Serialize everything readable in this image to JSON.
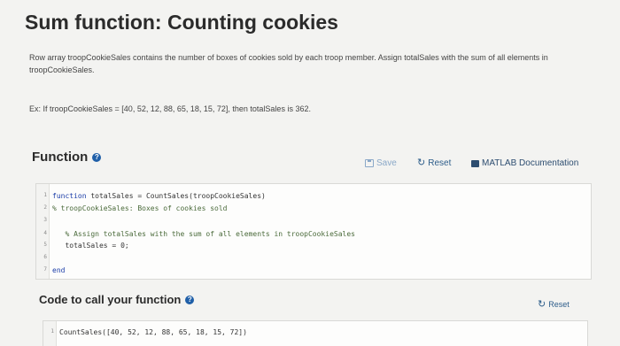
{
  "page": {
    "title": "Sum function: Counting cookies",
    "description": "Row array troopCookieSales contains the number of boxes of cookies sold by each troop member. Assign totalSales with the sum of all elements in troopCookieSales.",
    "example": "Ex: If troopCookieSales = [40, 52, 12, 88, 65, 18, 15, 72], then totalSales is 362."
  },
  "function_section": {
    "title": "Function",
    "help_icon": "help-icon",
    "save_label": "Save",
    "reset_label": "Reset",
    "doc_label": "MATLAB Documentation",
    "code_lines": [
      {
        "num": "1",
        "kw": "function",
        "text": " totalSales = CountSales(troopCookieSales)"
      },
      {
        "num": "2",
        "kw": "",
        "text": "% troopCookieSales: Boxes of cookies sold",
        "comment": true
      },
      {
        "num": "3",
        "kw": "",
        "text": ""
      },
      {
        "num": "4",
        "kw": "",
        "text": "   % Assign totalSales with the sum of all elements in troopCookieSales",
        "comment": true
      },
      {
        "num": "5",
        "kw": "",
        "text": "   totalSales = 0;"
      },
      {
        "num": "6",
        "kw": "",
        "text": ""
      },
      {
        "num": "7",
        "kw": "end",
        "text": ""
      }
    ]
  },
  "call_section": {
    "title": "Code to call your function",
    "reset_label": "Reset",
    "code_lines": [
      {
        "num": "1",
        "text": "CountSales([40, 52, 12, 88, 65, 18, 15, 72])"
      }
    ]
  }
}
